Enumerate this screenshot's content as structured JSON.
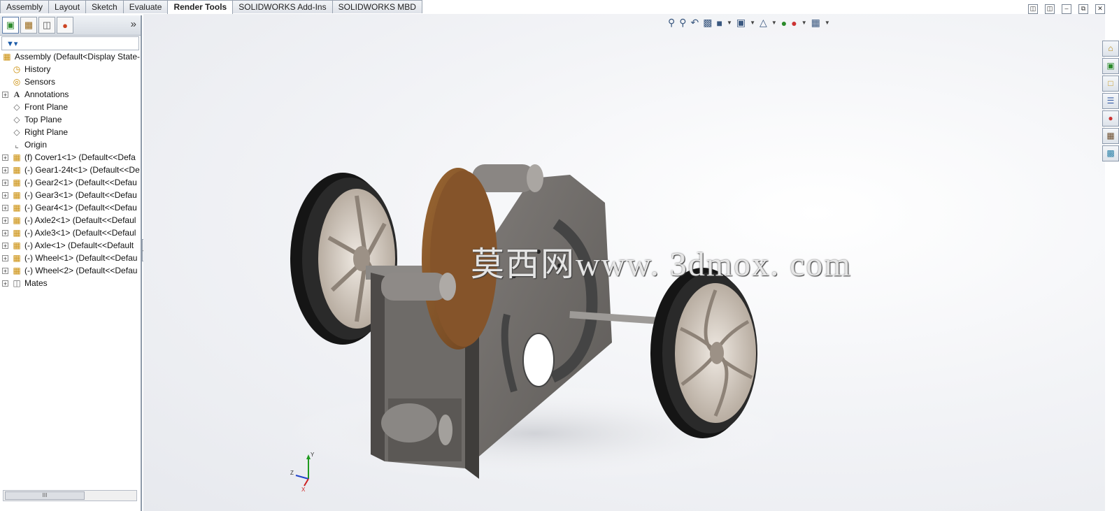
{
  "tabs": [
    "Assembly",
    "Layout",
    "Sketch",
    "Evaluate",
    "Render Tools",
    "SOLIDWORKS Add-Ins",
    "SOLIDWORKS MBD"
  ],
  "active_tab": "Render Tools",
  "panel": {
    "expand_symbol": "»",
    "tree": [
      {
        "label": "Assembly  (Default<Display State-",
        "icon": "assembly-icon",
        "expandable": false,
        "root": true
      },
      {
        "label": "History",
        "icon": "history-icon",
        "expandable": false
      },
      {
        "label": "Sensors",
        "icon": "sensor-icon",
        "expandable": false
      },
      {
        "label": "Annotations",
        "icon": "annotation-icon",
        "expandable": true
      },
      {
        "label": "Front Plane",
        "icon": "plane-icon",
        "expandable": false
      },
      {
        "label": "Top Plane",
        "icon": "plane-icon",
        "expandable": false
      },
      {
        "label": "Right Plane",
        "icon": "plane-icon",
        "expandable": false
      },
      {
        "label": "Origin",
        "icon": "origin-icon",
        "expandable": false
      },
      {
        "label": "(f) Cover1<1> (Default<<Defa",
        "icon": "part-icon",
        "expandable": true
      },
      {
        "label": "(-) Gear1-24t<1> (Default<<De",
        "icon": "part-icon",
        "expandable": true
      },
      {
        "label": "(-) Gear2<1> (Default<<Defau",
        "icon": "part-icon",
        "expandable": true
      },
      {
        "label": "(-) Gear3<1> (Default<<Defau",
        "icon": "part-icon",
        "expandable": true
      },
      {
        "label": "(-) Gear4<1> (Default<<Defau",
        "icon": "part-icon",
        "expandable": true
      },
      {
        "label": "(-) Axle2<1> (Default<<Defaul",
        "icon": "part-icon",
        "expandable": true
      },
      {
        "label": "(-) Axle3<1> (Default<<Defaul",
        "icon": "part-icon",
        "expandable": true
      },
      {
        "label": "(-) Axle<1> (Default<<Default",
        "icon": "part-icon",
        "expandable": true
      },
      {
        "label": "(-) Wheel<1> (Default<<Defau",
        "icon": "part-icon",
        "expandable": true
      },
      {
        "label": "(-) Wheel<2> (Default<<Defau",
        "icon": "part-icon",
        "expandable": true
      },
      {
        "label": "Mates",
        "icon": "mates-icon",
        "expandable": true
      }
    ],
    "scroll_thumb": "III"
  },
  "watermark": "莫西网www. 3dmox. com",
  "triad": {
    "y": "Y",
    "z": "Z",
    "x": "X"
  },
  "colors": {
    "body": "#6d6a68",
    "cover": "#8a5a2e",
    "tire": "#1e1e1e",
    "rim": "#d8cfc4"
  }
}
